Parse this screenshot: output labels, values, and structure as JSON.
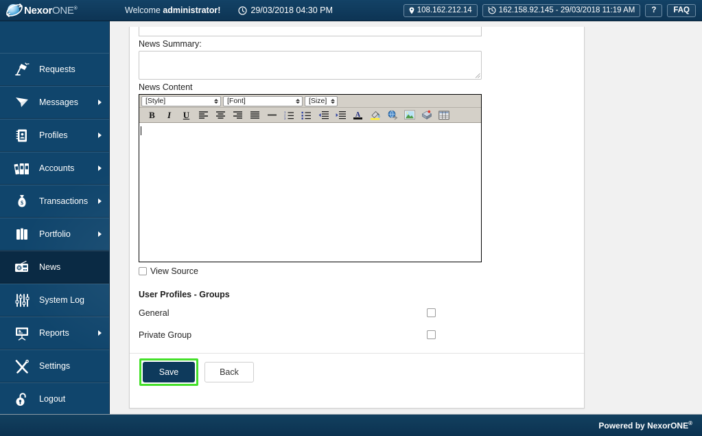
{
  "header": {
    "brand_main": "Nexor",
    "brand_sub": "ONE",
    "brand_reg": "®",
    "welcome_prefix": "Welcome ",
    "welcome_user": "administrator!",
    "clock_icon": "clock-icon",
    "datetime": "29/03/2018 04:30 PM",
    "ip_icon": "location-pin-icon",
    "ip_address": "108.162.212.14",
    "history_icon": "history-clock-icon",
    "last_login": "162.158.92.145 - 29/03/2018 11:19 AM",
    "help_label": "?",
    "faq_label": "FAQ"
  },
  "sidebar": {
    "items": [
      {
        "label": "Requests",
        "icon": "desk-lamp-icon",
        "arrow": false,
        "active": false
      },
      {
        "label": "Messages",
        "icon": "paper-plane-icon",
        "arrow": true,
        "active": false
      },
      {
        "label": "Profiles",
        "icon": "address-book-icon",
        "arrow": true,
        "active": false
      },
      {
        "label": "Accounts",
        "icon": "binders-icon",
        "arrow": true,
        "active": false
      },
      {
        "label": "Transactions",
        "icon": "money-bag-icon",
        "arrow": true,
        "active": false
      },
      {
        "label": "Portfolio",
        "icon": "briefcase-icon",
        "arrow": true,
        "active": false
      },
      {
        "label": "News",
        "icon": "radio-icon",
        "arrow": false,
        "active": true
      },
      {
        "label": "System Log",
        "icon": "sliders-icon",
        "arrow": false,
        "active": false
      },
      {
        "label": "Reports",
        "icon": "presentation-icon",
        "arrow": true,
        "active": false
      },
      {
        "label": "Settings",
        "icon": "tools-icon",
        "arrow": false,
        "active": false
      },
      {
        "label": "Logout",
        "icon": "unlock-icon",
        "arrow": false,
        "active": false
      }
    ]
  },
  "form": {
    "summary_label": "News Summary:",
    "summary_value": "",
    "content_label": "News Content",
    "title_value": "",
    "view_source_label": "View Source",
    "view_source_checked": false,
    "groups_title": "User Profiles - Groups",
    "groups": [
      {
        "name": "General",
        "checked": false
      },
      {
        "name": "Private Group",
        "checked": false
      }
    ]
  },
  "editor": {
    "style_select": "[Style]",
    "font_select": "[Font]",
    "size_select": "[Size]",
    "body_text": "",
    "toolbar": [
      {
        "name": "bold-icon",
        "glyph": "B"
      },
      {
        "name": "italic-icon",
        "glyph": "I"
      },
      {
        "name": "underline-icon",
        "glyph": "U"
      },
      {
        "name": "align-left-icon",
        "glyph": ""
      },
      {
        "name": "align-center-icon",
        "glyph": ""
      },
      {
        "name": "align-right-icon",
        "glyph": ""
      },
      {
        "name": "align-justify-icon",
        "glyph": ""
      },
      {
        "name": "horizontal-rule-icon",
        "glyph": ""
      },
      {
        "name": "ordered-list-icon",
        "glyph": ""
      },
      {
        "name": "unordered-list-icon",
        "glyph": ""
      },
      {
        "name": "indent-decrease-icon",
        "glyph": ""
      },
      {
        "name": "indent-increase-icon",
        "glyph": ""
      },
      {
        "name": "font-color-icon",
        "glyph": ""
      },
      {
        "name": "highlight-color-icon",
        "glyph": ""
      },
      {
        "name": "insert-link-icon",
        "glyph": ""
      },
      {
        "name": "insert-image-icon",
        "glyph": ""
      },
      {
        "name": "insert-flash-icon",
        "glyph": ""
      },
      {
        "name": "insert-table-icon",
        "glyph": ""
      }
    ]
  },
  "buttons": {
    "save_label": "Save",
    "back_label": "Back"
  },
  "footer": {
    "powered_by": "Powered by NexorONE",
    "registered": "®"
  },
  "colors": {
    "brand_dark": "#0e3a5c",
    "sidebar": "#10456c",
    "highlight_green": "#45e02a",
    "page_bg": "#f1f1f1"
  }
}
